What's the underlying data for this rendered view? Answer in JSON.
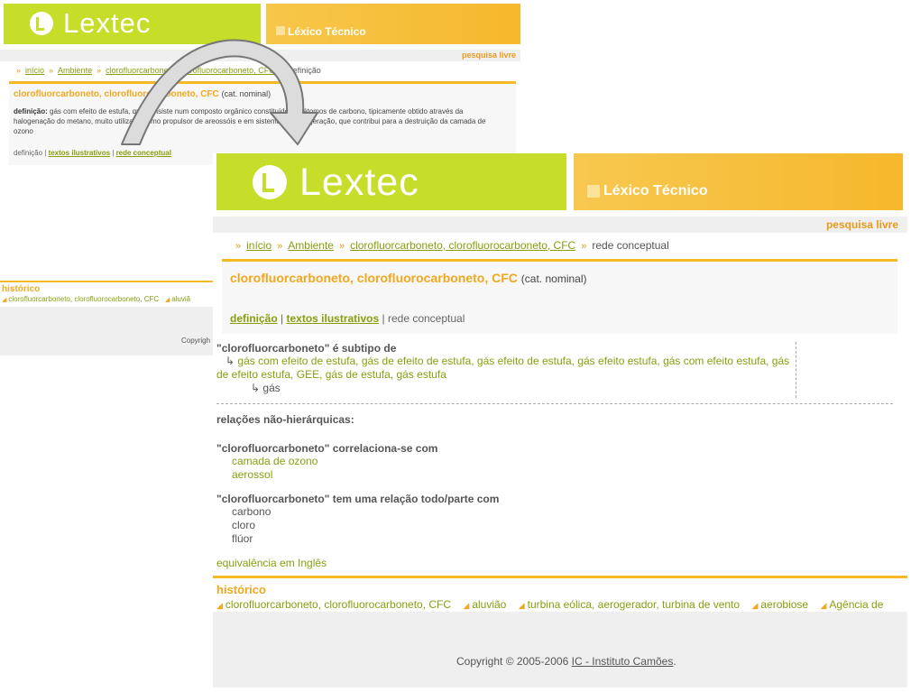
{
  "logo_text": "Lextec",
  "site_title": "Léxico Técnico",
  "search_link": "pesquisa livre",
  "breadcrumb": {
    "sep": "»",
    "home": "início",
    "category": "Ambiente",
    "term": "clorofluorcarboneto, clorofluorocarboneto, CFC",
    "back_current": "definição",
    "front_current": "rede conceptual"
  },
  "term": {
    "name": "clorofluorcarboneto, clorofluorocarboneto, CFC",
    "category": "(cat. nominal)"
  },
  "back": {
    "definition_label": "definição:",
    "definition_text": "gás com efeito de estufa, que consiste num composto orgânico constituído por átomos de carbono, tipicamente obtido através da halogenação do metano, muito utilizado como propulsor de areossóis e em sistemas de refrigeração, que contribui para a destruição da camada de ozono",
    "tab_current": "definição",
    "tab_texts": "textos ilustrativos",
    "tab_network": "rede conceptual"
  },
  "front": {
    "tab_definition": "definição",
    "tab_texts": "textos ilustrativos",
    "tab_current": "rede conceptual",
    "subtype_label": "\"clorofluorcarboneto\" é subtipo de",
    "subtype_arrow": "↳",
    "subtype_parent": "gás com efeito de estufa, gás de efeito de estufa, gás efeito de estufa, gás efeito estufa, gás com efeito estufa, gás de efeito estufa, GEE, gás de estufa, gás estufa",
    "subtype_grandparent": "gás",
    "nonhier_label": "relações não-hierárquicas:",
    "correl_label": "\"clorofluorcarboneto\" correlaciona-se com",
    "correl_items": [
      "camada de ozono",
      "aerossol"
    ],
    "partof_label": "\"clorofluorcarboneto\" tem uma relação todo/parte com",
    "partof_items": [
      "carbono",
      "cloro",
      "flúor"
    ],
    "equivalence_link": "equivalência em Inglês"
  },
  "history": {
    "title": "histórico",
    "back_items": [
      "clorofluorcarboneto, clorofluorocarboneto, CFC",
      "aluviã"
    ],
    "front_items": [
      "clorofluorcarboneto, clorofluorocarboneto, CFC",
      "aluvião",
      "turbina eólica, aerogerador, turbina de vento",
      "aerobiose",
      "Agência de"
    ]
  },
  "footer": {
    "copyright": "Copyright © 2005-2006",
    "back_copy": "Copyrigh",
    "owner_link": "IC - Instituto Camões",
    "period": "."
  },
  "colors": {
    "brand_green": "#c6dd2a",
    "brand_orange": "#f6b82c",
    "link_green": "#8a9d0e",
    "term_orange": "#f0a820"
  }
}
